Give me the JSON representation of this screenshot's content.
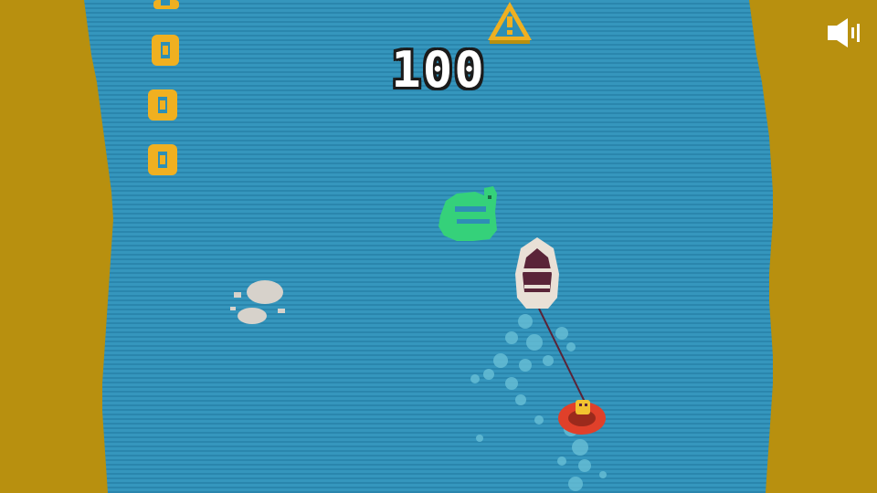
{
  "hud": {
    "score": "100",
    "sound_icon": "speaker-on-icon"
  },
  "colors": {
    "water": "#2e8fb5",
    "riverbank": "#b8900f",
    "coin": "#f0b020",
    "crocodile": "#35d17a",
    "boat_hull": "#e9e0d6",
    "boat_deck": "#5a2438",
    "tube": "#e0402a",
    "rider": "#f2c230",
    "rock": "#d7d2cb",
    "warning_sign": "#f0b020"
  },
  "icons": {
    "coin": "coin-icon",
    "warning": "warning-buoy-icon",
    "crocodile": "crocodile-icon",
    "rock": "rock-icon",
    "boat": "speedboat-icon",
    "tube": "inner-tube-rider-icon"
  }
}
